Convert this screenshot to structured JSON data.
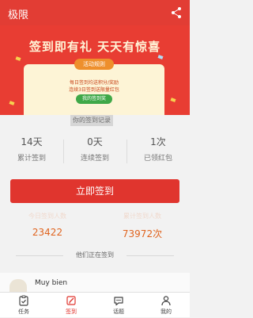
{
  "header": {
    "title": "极限"
  },
  "banner": {
    "headline": "签到即有礼 天天有惊喜",
    "rule_tab": "活动规则",
    "line1": "每日签到均送积分/奖励",
    "line2": "连续3日签到送限量红包",
    "mine_button": "我的签到奖"
  },
  "record_link": "你的签到记录",
  "stats": [
    {
      "value": "14天",
      "label": "累计签到"
    },
    {
      "value": "0天",
      "label": "连续签到"
    },
    {
      "value": "1次",
      "label": "已领红包"
    }
  ],
  "signin_button": "立即签到",
  "counts": [
    {
      "caption": "今日签到人数",
      "value": "23422"
    },
    {
      "caption": "累计签到人数",
      "value": "73972次"
    }
  ],
  "doing_title": "他们正在签到",
  "user": {
    "name": "Muy bien"
  },
  "tabs": [
    {
      "label": "任务",
      "icon": "clipboard-icon"
    },
    {
      "label": "签到",
      "icon": "edit-icon"
    },
    {
      "label": "话题",
      "icon": "chat-bubble-icon"
    },
    {
      "label": "我的",
      "icon": "person-icon"
    }
  ],
  "colors": {
    "brand_red": "#e23d34",
    "orange": "#e0641f",
    "green": "#3fa848"
  }
}
